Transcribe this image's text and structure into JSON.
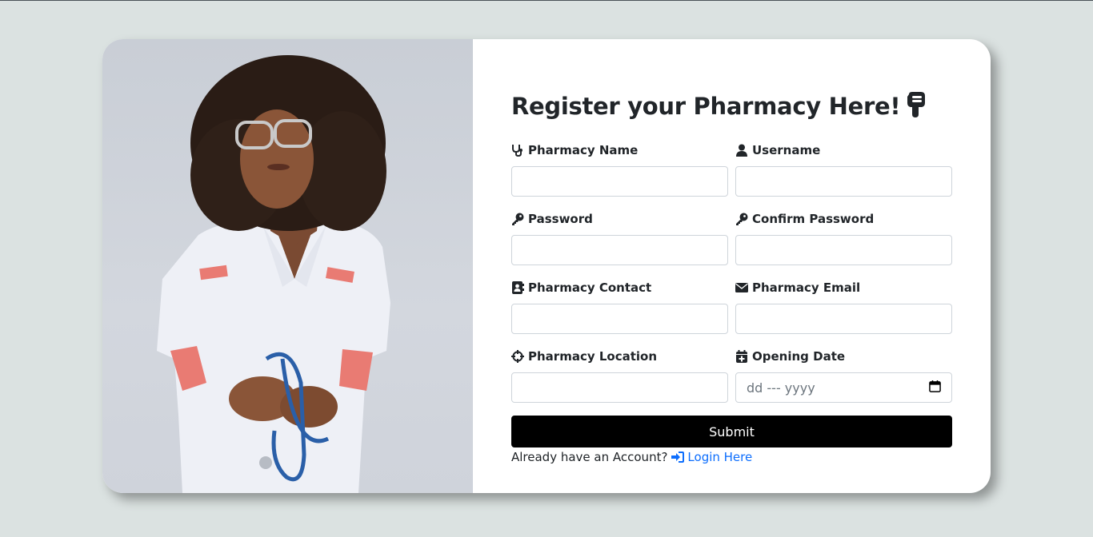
{
  "colors": {
    "page_bg": "#dbe2e1",
    "card_bg": "#ffffff",
    "submit_bg": "#000000",
    "link": "#0d6efd",
    "text": "#212529"
  },
  "form": {
    "title": "Register your Pharmacy Here!",
    "title_icon": "hand-pointing-down-icon",
    "fields": [
      {
        "label": "Pharmacy Name",
        "icon": "stethoscope-icon",
        "value": ""
      },
      {
        "label": "Username",
        "icon": "user-icon",
        "value": ""
      },
      {
        "label": "Password",
        "icon": "key-icon",
        "value": ""
      },
      {
        "label": "Confirm Password",
        "icon": "key-icon",
        "value": ""
      },
      {
        "label": "Pharmacy Contact",
        "icon": "address-book-icon",
        "value": ""
      },
      {
        "label": "Pharmacy Email",
        "icon": "envelope-icon",
        "value": ""
      },
      {
        "label": "Pharmacy Location",
        "icon": "crosshairs-icon",
        "value": ""
      },
      {
        "label": "Opening Date",
        "icon": "calendar-plus-icon",
        "placeholder": "dd --- yyyy"
      }
    ],
    "submit_label": "Submit",
    "login_prompt": "Already have an Account?",
    "login_link": "Login Here",
    "login_icon": "sign-in-icon"
  }
}
